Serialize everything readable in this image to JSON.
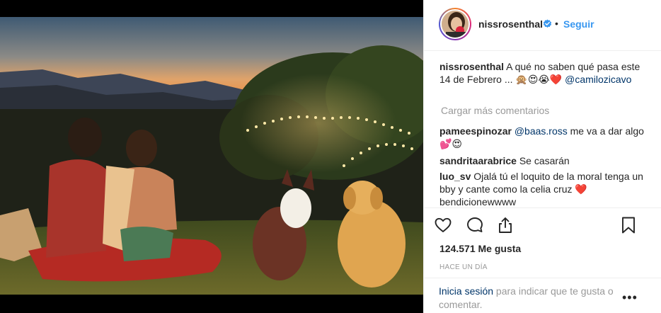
{
  "post": {
    "username": "nissrosenthal",
    "verified": true,
    "follow_label": "Seguir",
    "separator": "•",
    "caption": {
      "username": "nissrosenthal",
      "text": "A qué no saben qué pasa este 14 de Febrero ... 🙊😍😭❤️",
      "mention": "@camilozicavo"
    },
    "load_more_label": "Cargar más comentarios",
    "comments": [
      {
        "username": "pameespinozar",
        "mention": "@baas.ross",
        "text": " me va a dar algo 💕😍"
      },
      {
        "username": "sandritaarabrice",
        "text": "Se casarán"
      },
      {
        "username": "luo_sv",
        "text": "Ojalá tú el loquito de la moral tenga un bby y cante como la celia cruz ❤️ bendicionewwww"
      }
    ],
    "likes": "124.571 Me gusta",
    "time": "HACE UN DÍA",
    "footer": {
      "login_label": "Inicia sesión",
      "text": " para indicar que te gusta o comentar."
    },
    "more_label": "•••"
  },
  "icons": {
    "like": "heart-outline-icon",
    "comment": "speech-bubble-icon",
    "share": "share-icon",
    "save": "bookmark-icon",
    "verified": "verified-badge-icon",
    "more": "more-options-icon"
  },
  "colors": {
    "link_blue": "#3897f0",
    "mention_navy": "#003569",
    "secondary_gray": "#999999",
    "text": "#262626"
  }
}
